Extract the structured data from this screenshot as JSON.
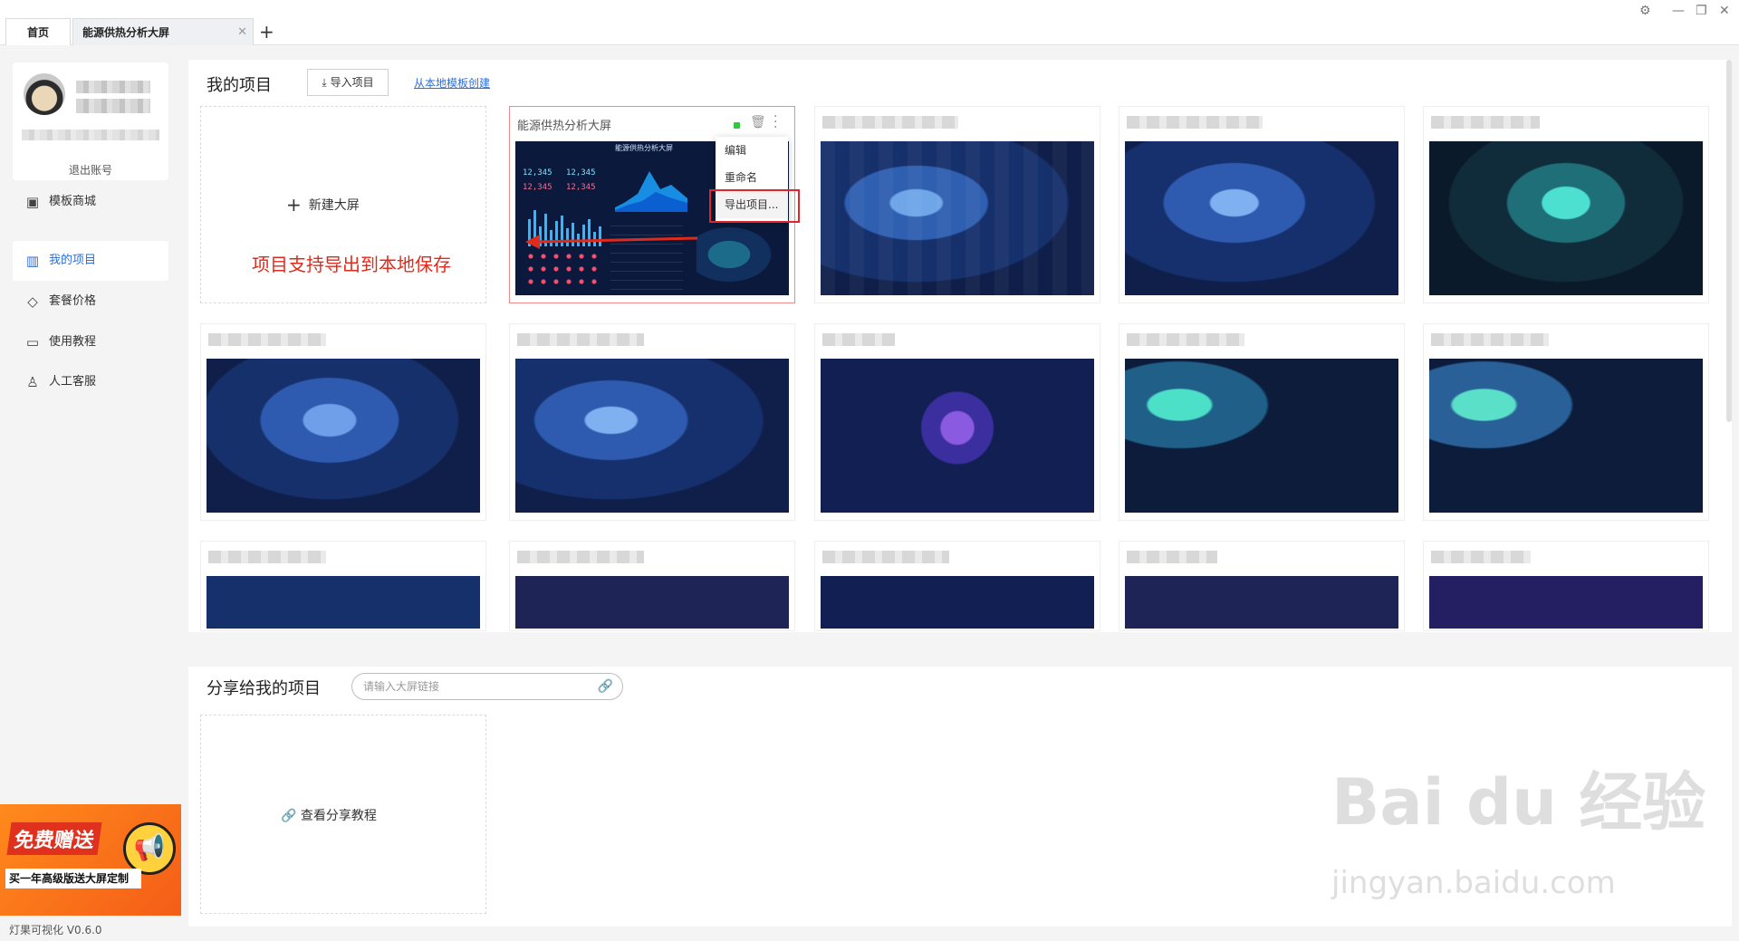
{
  "tabs": {
    "home": "首页",
    "doc": "能源供热分析大屏"
  },
  "sidebar": {
    "logout": "退出账号",
    "items": [
      {
        "label": "模板商城",
        "icon": "image-icon"
      },
      {
        "label": "我的项目",
        "icon": "chart-icon",
        "active": true
      },
      {
        "label": "套餐价格",
        "icon": "tag-icon"
      },
      {
        "label": "使用教程",
        "icon": "book-icon"
      },
      {
        "label": "人工客服",
        "icon": "user-icon"
      }
    ],
    "promo": {
      "title": "免费赠送",
      "subtitle": "买一年高级版送大屏定制"
    },
    "version": "灯果可视化 V0.6.0"
  },
  "my_projects": {
    "title": "我的项目",
    "import_label": "导入项目",
    "local_template_link": "从本地模板创建",
    "new_label": "新建大屏",
    "annotation": "项目支持导出到本地保存",
    "featured": {
      "title": "能源供热分析大屏",
      "dash_title": "能源供热分析大屏",
      "kpi1": "12,345",
      "kpi2": "12,345",
      "kpi3": "12,345",
      "kpi4": "12,345"
    },
    "context_menu": [
      "编辑",
      "重命名",
      "导出项目..."
    ]
  },
  "shared": {
    "title": "分享给我的项目",
    "placeholder": "请输入大屏链接",
    "tutorial_label": "查看分享教程"
  },
  "watermark": {
    "brand": "Bai du 经验",
    "url": "jingyan.baidu.com"
  },
  "colors": {
    "accent": "#2f6fd6",
    "annotation": "#e02b1c",
    "card_bg": "#0f1f4a"
  }
}
